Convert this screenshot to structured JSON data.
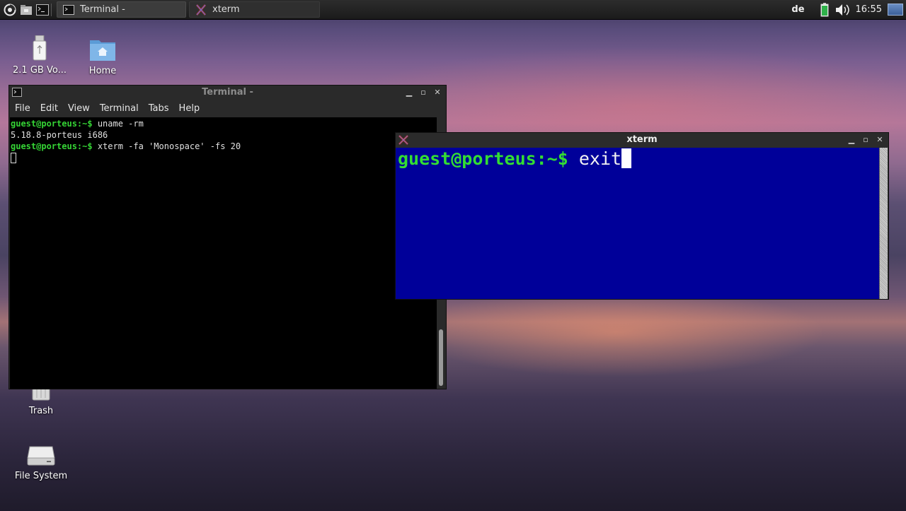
{
  "taskbar": {
    "tasks": [
      {
        "label": "Terminal -"
      },
      {
        "label": "xterm"
      }
    ],
    "keyboard_layout": "de",
    "clock": "16:55"
  },
  "desktop_icons": [
    {
      "label": "2.1 GB Vo...",
      "icon": "usb-drive-icon"
    },
    {
      "label": "Home",
      "icon": "home-folder-icon"
    },
    {
      "label": "Trash",
      "icon": "trash-icon"
    },
    {
      "label": "File System",
      "icon": "hard-drive-icon"
    }
  ],
  "terminal": {
    "title": "Terminal -",
    "menu": [
      "File",
      "Edit",
      "View",
      "Terminal",
      "Tabs",
      "Help"
    ],
    "lines": [
      {
        "prompt": "guest@porteus:~$",
        "text": " uname -rm"
      },
      {
        "prompt": "",
        "text": "5.18.8-porteus i686"
      },
      {
        "prompt": "guest@porteus:~$",
        "text": " xterm -fa 'Monospace' -fs 20"
      }
    ]
  },
  "xterm": {
    "title": "xterm",
    "prompt": "guest@porteus:~$",
    "command": " exit",
    "background": "#000099"
  }
}
